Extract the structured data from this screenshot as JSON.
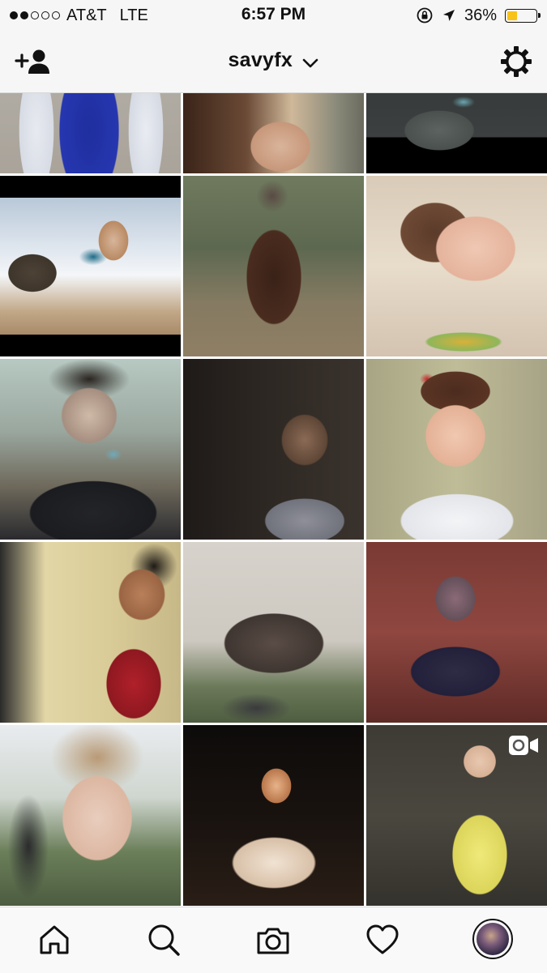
{
  "status": {
    "carrier": "AT&T",
    "network": "LTE",
    "time": "6:57 PM",
    "battery": "36%",
    "battery_level": 0.36,
    "signal_bars_filled": 2,
    "signal_bars_total": 5
  },
  "header": {
    "username": "savyfx",
    "add_user_icon": "add-user-icon",
    "dropdown_icon": "chevron-down-icon",
    "settings_icon": "gear-icon"
  },
  "grid": {
    "video_badge_icon": "video-camera-icon"
  },
  "tabbar": {
    "items": [
      "home-icon",
      "search-icon",
      "camera-icon",
      "heart-icon",
      "profile-avatar"
    ]
  }
}
